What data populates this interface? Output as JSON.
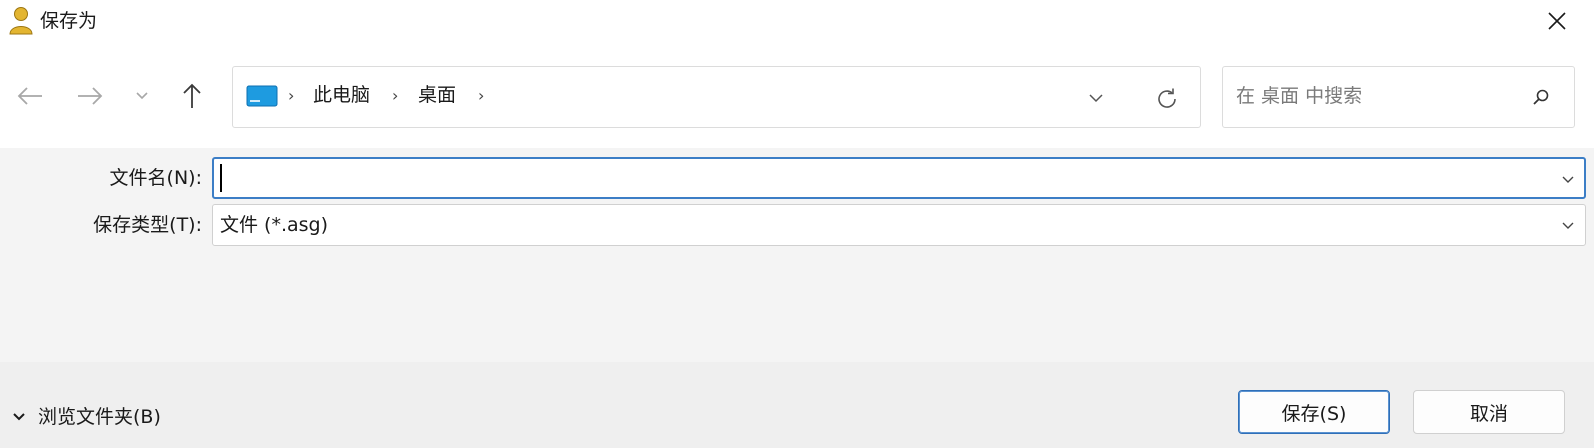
{
  "window": {
    "title": "保存为",
    "app_icon": "user-icon",
    "close_icon": "close-icon"
  },
  "nav": {
    "back_icon": "arrow-left-icon",
    "forward_icon": "arrow-right-icon",
    "recent_icon": "chevron-down-icon",
    "up_icon": "arrow-up-icon"
  },
  "address": {
    "root_icon": "computer-icon",
    "separator": "›",
    "breadcrumbs": [
      "此电脑",
      "桌面"
    ],
    "dropdown_icon": "chevron-down-icon",
    "refresh_icon": "refresh-icon"
  },
  "search": {
    "placeholder": "在 桌面 中搜索",
    "value": "",
    "icon": "search-icon"
  },
  "form": {
    "filename_label": "文件名(N):",
    "filename_value": "",
    "filetype_label": "保存类型(T):",
    "filetype_value": "文件 (*.asg)"
  },
  "footer": {
    "browse_label": "浏览文件夹(B)",
    "save_label": "保存(S)",
    "cancel_label": "取消"
  },
  "colors": {
    "accent": "#3c7ec6",
    "form_bg": "#f4f4f4",
    "footer_bg": "#efefef"
  }
}
